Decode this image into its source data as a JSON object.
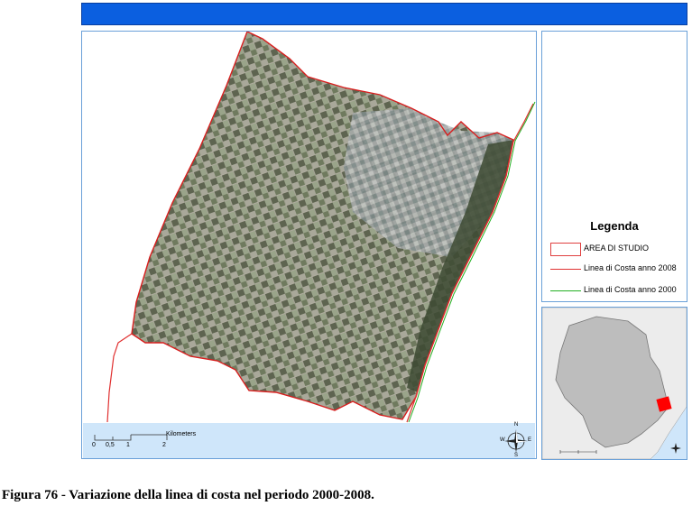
{
  "header": {
    "bar_color": "#0b5fe0"
  },
  "map": {
    "study_area_outline_color": "#d81e1e",
    "coast_2008_color": "#e03030",
    "coast_2000_color": "#22b022",
    "scale": {
      "ticks": [
        "0",
        "0,5",
        "1",
        "2"
      ],
      "unit": "Kilometers"
    },
    "north_arrow": {
      "n": "N",
      "s": "S",
      "e": "E",
      "w": "W"
    }
  },
  "legend": {
    "title": "Legenda",
    "items": [
      {
        "label": "AREA DI STUDIO",
        "symbol": "red-outline-box",
        "color": "#e04040"
      },
      {
        "label": "Linea di Costa anno 2008",
        "symbol": "red-line",
        "color": "#e03030"
      },
      {
        "label": "Linea di Costa anno 2000",
        "symbol": "green-line",
        "color": "#22b022"
      }
    ]
  },
  "inset": {
    "land_color": "#ececec",
    "region_color": "#bdbdbd",
    "sea_color": "#cfe6fa",
    "highlight_color": "#ff0000"
  },
  "caption": "Figura 76 - Variazione della linea di costa nel periodo 2000-2008."
}
